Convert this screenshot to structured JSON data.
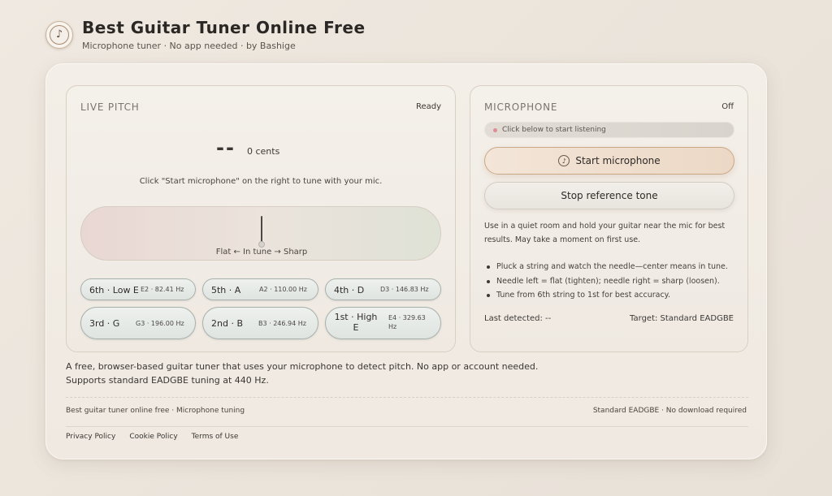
{
  "header": {
    "title": "Best Guitar Tuner Online Free",
    "subtitle": "Microphone tuner · No app needed · by Bashige",
    "logo_icon": "music-note-icon"
  },
  "live_pitch": {
    "label": "LIVE PITCH",
    "status": "Ready",
    "note": "--",
    "cents": "0 cents",
    "hint": "Click \"Start microphone\" on the right to tune with your mic.",
    "meter_label": "Flat ← In tune → Sharp",
    "needle_offset_cents": 0
  },
  "strings": [
    {
      "name": "6th · Low E",
      "hz": "E2 · 82.41 Hz"
    },
    {
      "name": "5th · A",
      "hz": "A2 · 110.00 Hz"
    },
    {
      "name": "4th · D",
      "hz": "D3 · 146.83 Hz"
    },
    {
      "name": "3rd · G",
      "hz": "G3 · 196.00 Hz"
    },
    {
      "name": "2nd · B",
      "hz": "B3 · 246.94 Hz"
    },
    {
      "name": "1st · High E",
      "hz": "E4 · 329.63 Hz"
    }
  ],
  "microphone": {
    "label": "MICROPHONE",
    "status": "Off",
    "status_text": "Click below to start listening",
    "start_button": "Start microphone",
    "start_icon": "music-note-icon",
    "stop_button": "Stop reference tone",
    "description": "Use in a quiet room and hold your guitar near the mic for best results. May take a moment on first use.",
    "tips": [
      "Pluck a string and watch the needle—center means in tune.",
      "Needle left = flat (tighten); needle right = sharp (loosen).",
      "Tune from 6th string to 1st for best accuracy."
    ],
    "last_detected": "Last detected: --",
    "target": "Target: Standard EADGBE"
  },
  "description": {
    "line1": "A free, browser-based guitar tuner that uses your microphone to detect pitch. No app or account needed.",
    "line2": "Supports standard EADGBE tuning at 440 Hz."
  },
  "footer": {
    "left": "Best guitar tuner online free · Microphone tuning",
    "right": "Standard EADGBE · No download required",
    "links": [
      "Privacy Policy",
      "Cookie Policy",
      "Terms of Use"
    ]
  }
}
